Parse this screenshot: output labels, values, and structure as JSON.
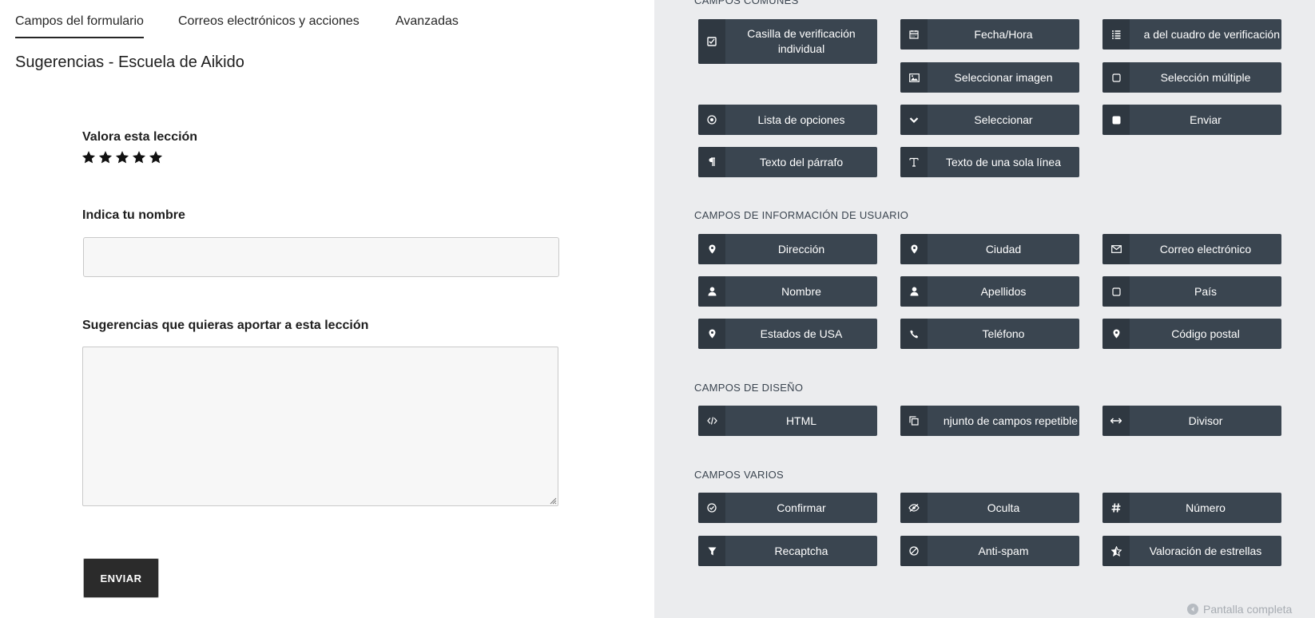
{
  "tabs": [
    {
      "label": "Campos del formulario",
      "active": true
    },
    {
      "label": "Correos electrónicos y acciones",
      "active": false
    },
    {
      "label": "Avanzadas",
      "active": false
    }
  ],
  "form": {
    "title": "Sugerencias - Escuela de Aikido",
    "rating_label": "Valora esta lección",
    "rating_stars": 5,
    "name_label": "Indica tu nombre",
    "name_value": "",
    "suggestions_label": "Sugerencias que quieras aportar a esta lección",
    "suggestions_value": "",
    "submit_label": "ENVIAR"
  },
  "sections": [
    {
      "title": "CAMPOS COMUNES"
    },
    {
      "title": "CAMPOS DE INFORMACIÓN DE USUARIO"
    },
    {
      "title": "CAMPOS DE DISEÑO"
    },
    {
      "title": "CAMPOS VARIOS"
    }
  ],
  "fields": {
    "checkbox": {
      "label": "Casilla de verificación individual",
      "icon": "checkbox-icon"
    },
    "datetime": {
      "label": "Fecha/Hora",
      "icon": "calendar-icon"
    },
    "checklist": {
      "label": "a del cuadro de verificación",
      "icon": "list-icon"
    },
    "image_select": {
      "label": "Seleccionar imagen",
      "icon": "image-icon"
    },
    "multiselect": {
      "label": "Selección múltiple",
      "icon": "square-icon"
    },
    "radio": {
      "label": "Lista de opciones",
      "icon": "radio-icon"
    },
    "select": {
      "label": "Seleccionar",
      "icon": "chevron-down-icon"
    },
    "submit": {
      "label": "Enviar",
      "icon": "square-filled-icon"
    },
    "paragraph": {
      "label": "Texto del párrafo",
      "icon": "paragraph-icon"
    },
    "single_line": {
      "label": "Texto de una sola línea",
      "icon": "text-cursor-icon"
    },
    "address": {
      "label": "Dirección",
      "icon": "map-pin-icon"
    },
    "city": {
      "label": "Ciudad",
      "icon": "map-pin-icon"
    },
    "email": {
      "label": "Correo electrónico",
      "icon": "envelope-icon"
    },
    "first_name": {
      "label": "Nombre",
      "icon": "user-icon"
    },
    "last_name": {
      "label": "Apellidos",
      "icon": "user-icon"
    },
    "country": {
      "label": "País",
      "icon": "square-icon"
    },
    "us_states": {
      "label": "Estados de USA",
      "icon": "map-pin-icon"
    },
    "phone": {
      "label": "Teléfono",
      "icon": "phone-icon"
    },
    "zip": {
      "label": "Código postal",
      "icon": "map-pin-icon"
    },
    "html": {
      "label": "HTML",
      "icon": "code-icon"
    },
    "repeater": {
      "label": "njunto de campos repetible",
      "icon": "copy-icon"
    },
    "divider": {
      "label": "Divisor",
      "icon": "arrows-horizontal-icon"
    },
    "confirm": {
      "label": "Confirmar",
      "icon": "check-circle-icon"
    },
    "hidden": {
      "label": "Oculta",
      "icon": "eye-slash-icon"
    },
    "number": {
      "label": "Número",
      "icon": "hash-icon"
    },
    "recaptcha": {
      "label": "Recaptcha",
      "icon": "filter-icon"
    },
    "antispam": {
      "label": "Anti-spam",
      "icon": "ban-icon"
    },
    "star_rating": {
      "label": "Valoración de estrellas",
      "icon": "star-half-icon"
    }
  },
  "fullscreen_label": "Pantalla completa"
}
